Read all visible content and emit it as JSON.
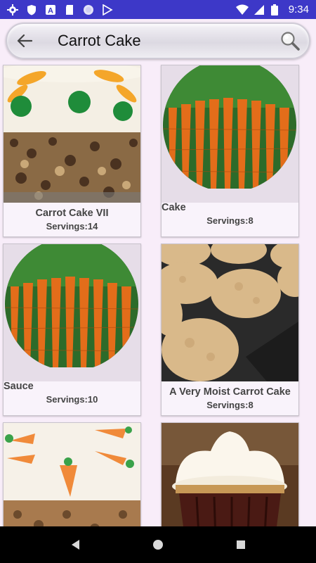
{
  "status_bar": {
    "time": "9:34",
    "icons": [
      "settings-icon",
      "shield-icon",
      "a-icon",
      "sd-card-icon",
      "circle-icon",
      "play-store-icon",
      "wifi-icon",
      "signal-icon",
      "battery-icon"
    ]
  },
  "search": {
    "query": "Carrot Cake",
    "back_icon": "arrow-back-icon",
    "search_icon": "magnifier-icon"
  },
  "recipes": [
    {
      "title": "Carrot Cake VII",
      "servings": "Servings:14",
      "image": "frosted-carrot-cake-side-photo"
    },
    {
      "title": "Best Gluten-Free Carrot Cake",
      "servings": "Servings:8",
      "image": "carrot-bunch-photo"
    },
    {
      "title": "Carrot Cake with Butter Sauce",
      "servings": "Servings:10",
      "image": "carrot-bunch-photo"
    },
    {
      "title": "A Very Moist Carrot Cake",
      "servings": "Servings:8",
      "image": "carrot-muffins-photo"
    },
    {
      "title": "",
      "servings": "",
      "image": "frosted-carrot-cake-top-photo"
    },
    {
      "title": "",
      "servings": "",
      "image": "carrot-cupcake-photo"
    }
  ],
  "nav": {
    "back": "nav-back-icon",
    "home": "nav-home-icon",
    "recents": "nav-recents-icon"
  },
  "colors": {
    "status_bar": "#3d38c8",
    "background": "#f8edf9",
    "card_text": "#444444"
  }
}
